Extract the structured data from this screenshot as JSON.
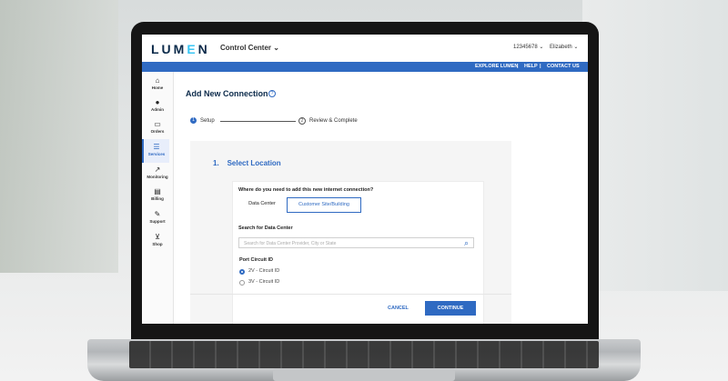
{
  "header": {
    "logo": "LUMEN",
    "app_name": "Control Center",
    "account_number": "12345678",
    "user_name": "Elizabeth"
  },
  "top_links": [
    "EXPLORE LUMEN",
    "HELP",
    "CONTACT US"
  ],
  "sidebar": {
    "items": [
      {
        "label": "Home",
        "icon": "home-icon"
      },
      {
        "label": "Admin",
        "icon": "user-icon"
      },
      {
        "label": "Orders",
        "icon": "inbox-icon"
      },
      {
        "label": "Services",
        "icon": "list-icon"
      },
      {
        "label": "Monitoring",
        "icon": "chart-icon"
      },
      {
        "label": "Billing",
        "icon": "document-icon"
      },
      {
        "label": "Support",
        "icon": "wrench-icon"
      },
      {
        "label": "Shop",
        "icon": "cart-icon"
      }
    ],
    "active": "Services"
  },
  "page": {
    "title": "Add New Connection",
    "steps": [
      {
        "number": "1",
        "label": "Setup"
      },
      {
        "number": "2",
        "label": "Review & Complete"
      }
    ]
  },
  "section": {
    "number": "1.",
    "title": "Select Location",
    "question": "Where do you need to add this new internet connection?",
    "options": [
      "Data Center",
      "Customer Site/Building"
    ],
    "selected_option": "Customer Site/Building",
    "search_label": "Search for Data Center",
    "search_placeholder": "Search for Data Center Provider, City or State",
    "port_label": "Port Circuit ID",
    "port_options": [
      "2V - Circuit ID",
      "3V - Circuit ID"
    ],
    "port_selected": "2V - Circuit ID"
  },
  "actions": {
    "cancel": "CANCEL",
    "continue": "CONTINUE"
  },
  "colors": {
    "accent": "#2f6ac2",
    "brand_dark": "#0b2a4a"
  }
}
